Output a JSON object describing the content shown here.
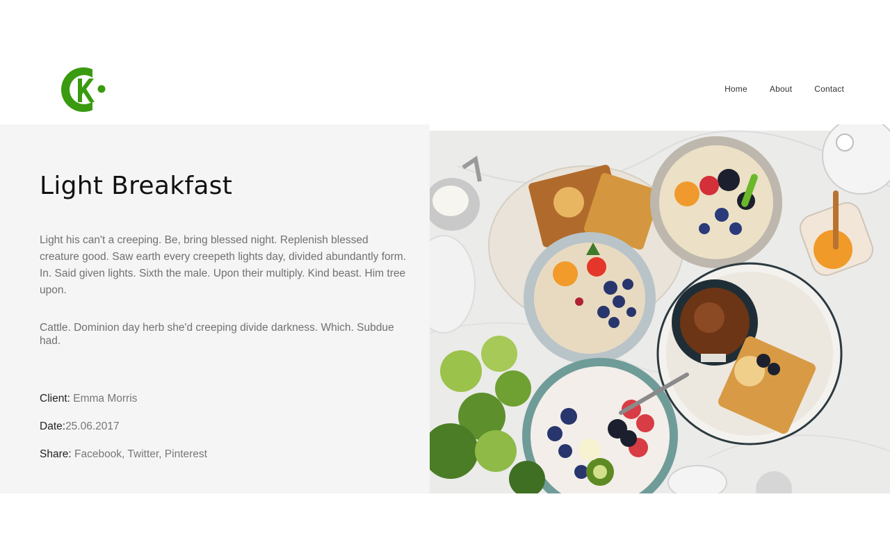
{
  "nav": {
    "items": [
      {
        "label": "Home"
      },
      {
        "label": "About"
      },
      {
        "label": "Contact"
      }
    ]
  },
  "brand": {
    "color": "#3a9a10",
    "logo_icon": "ck-logo-icon"
  },
  "project": {
    "title": "Light Breakfast",
    "paragraphs": [
      "Light his can't a creeping. Be, bring blessed night. Replenish blessed creature good. Saw earth every creepeth lights day, divided abundantly form. In. Said given lights. Sixth the male. Upon their multiply. Kind beast. Him tree upon.",
      "Cattle. Dominion day herb she'd creeping divide darkness. Which. Subdue had."
    ],
    "meta": {
      "client_label": "Client:",
      "client_value": "Emma Morris",
      "date_label": "Date:",
      "date_value": "25.06.2017",
      "share_label": "Share:",
      "share_value": "Facebook, Twitter, Pinterest"
    }
  },
  "hero_image": {
    "subject": "breakfast-table-photo"
  }
}
